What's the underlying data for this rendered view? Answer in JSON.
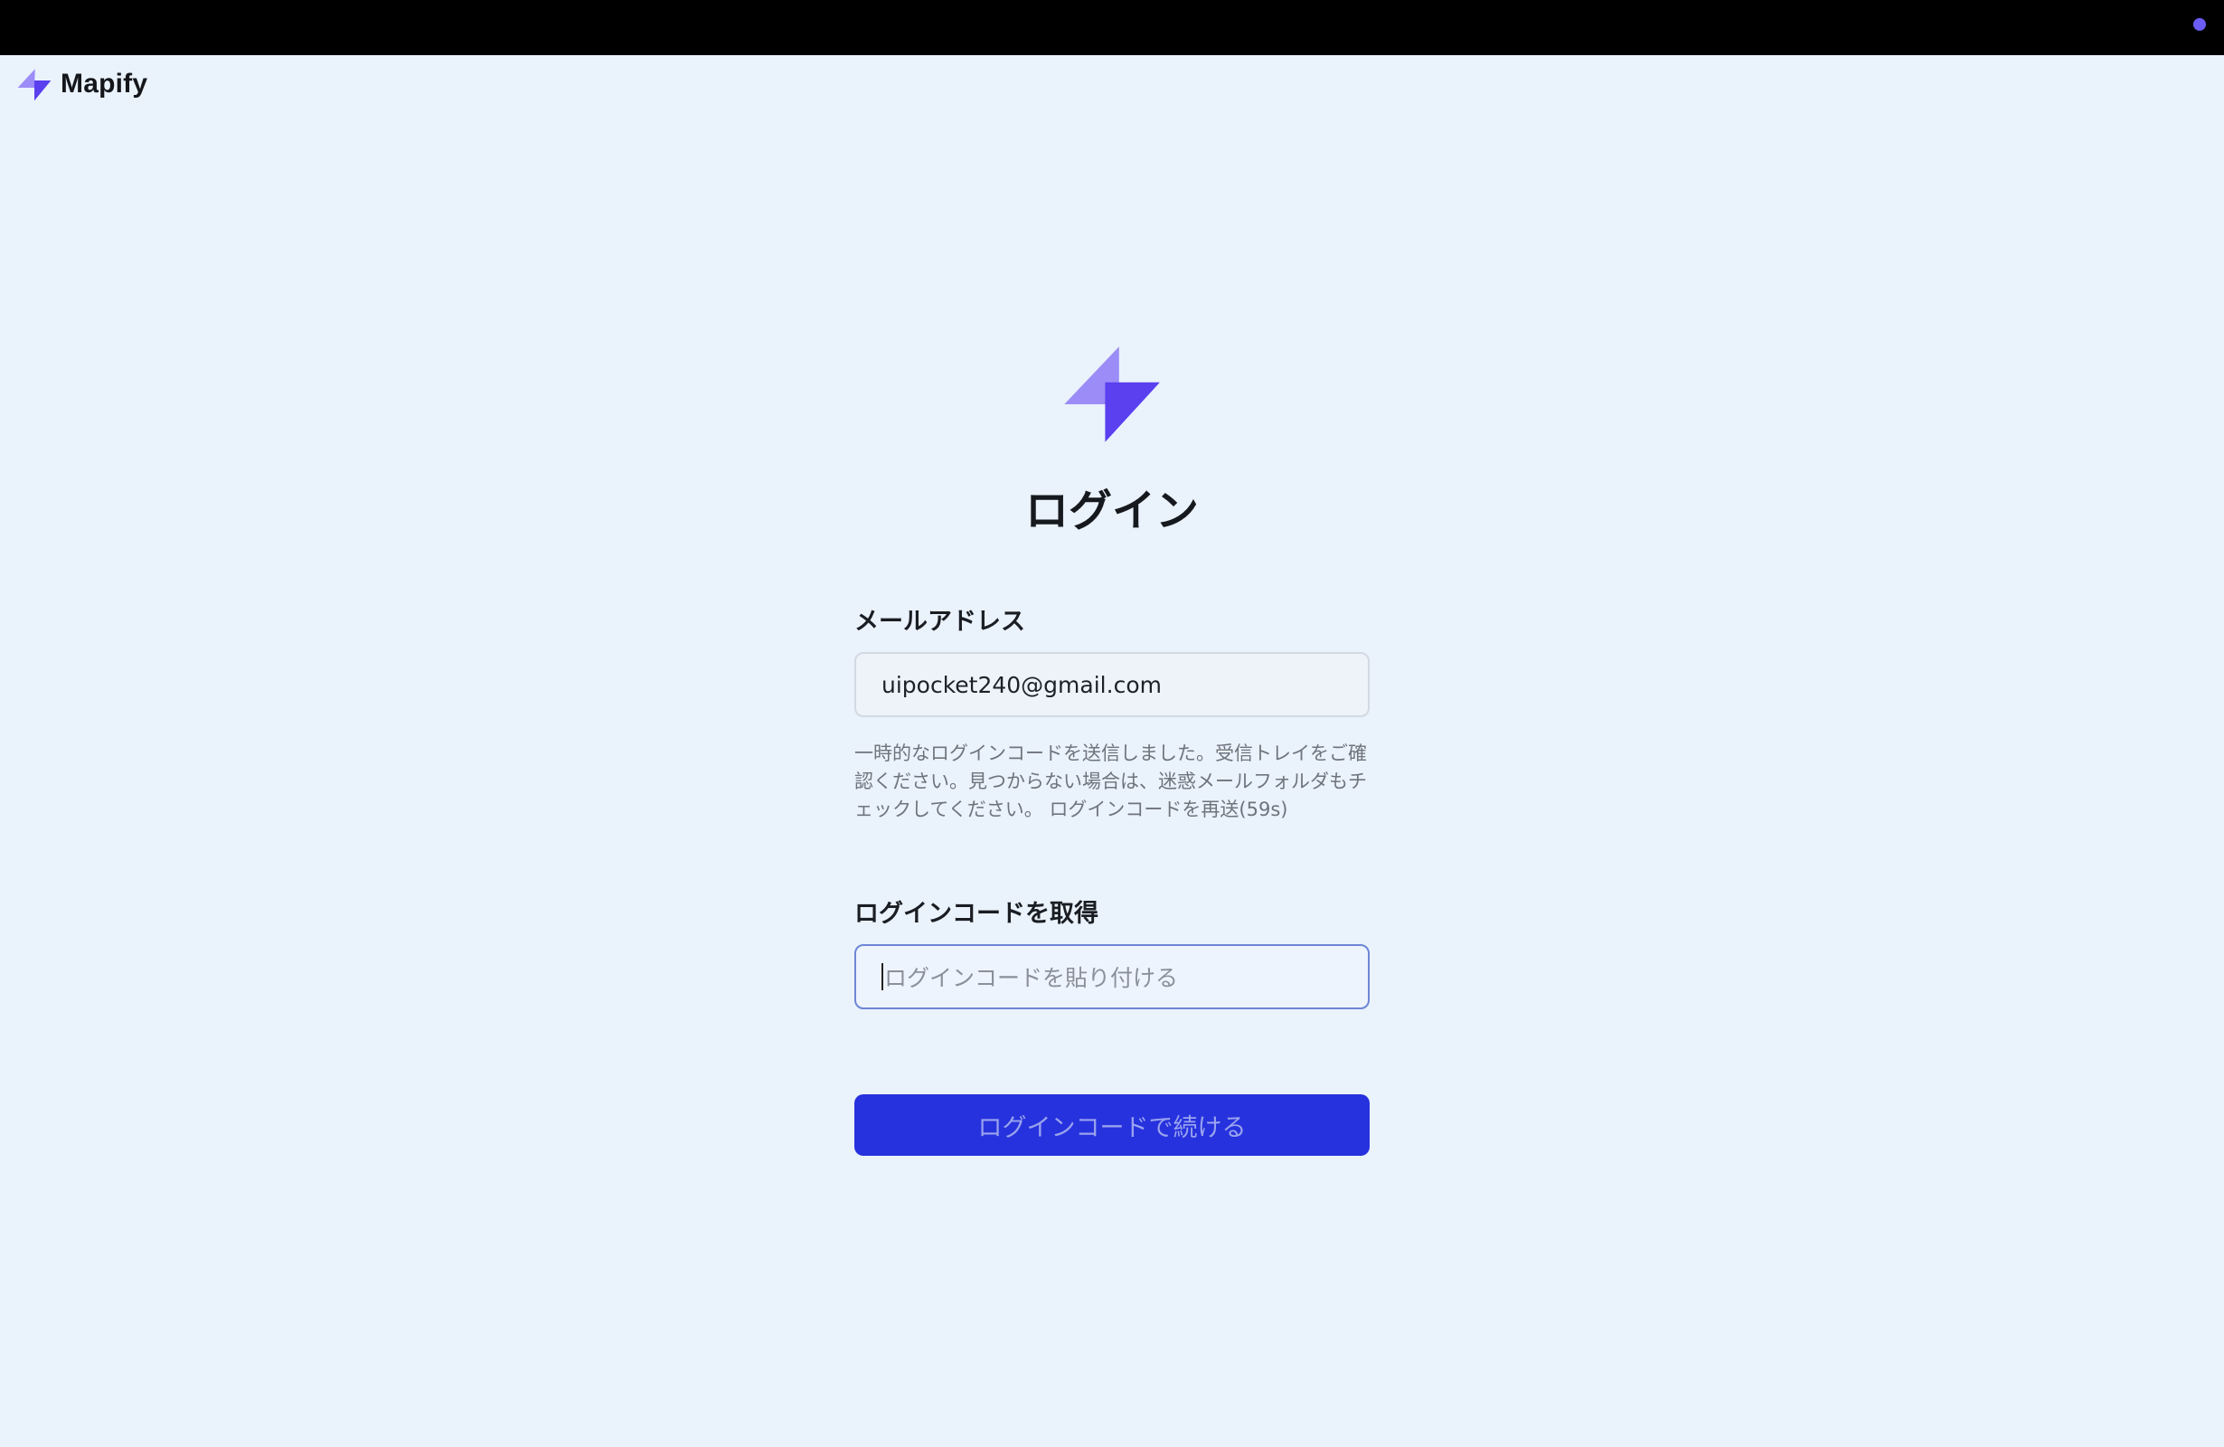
{
  "brand": {
    "name": "Mapify"
  },
  "page": {
    "title": "ログイン"
  },
  "email": {
    "label": "メールアドレス",
    "value": "uipocket240@gmail.com"
  },
  "hint": {
    "text": "一時的なログインコードを送信しました。受信トレイをご確認ください。見つからない場合は、迷惑メールフォルダもチェックしてください。",
    "resend": "ログインコードを再送(59s)"
  },
  "code": {
    "label": "ログインコードを取得",
    "placeholder": "ログインコードを貼り付ける",
    "value": ""
  },
  "submit": {
    "label": "ログインコードで続ける"
  },
  "colors": {
    "background": "#eaf2fc",
    "accent": "#2632dd",
    "logo_light": "#9b8cf7",
    "logo_dark": "#5a40ef",
    "topbar": "#000000"
  },
  "icons": {
    "brand_logo": "lightning-bolt-icon",
    "center_logo": "lightning-bolt-icon",
    "status_dot": "dot-icon"
  }
}
